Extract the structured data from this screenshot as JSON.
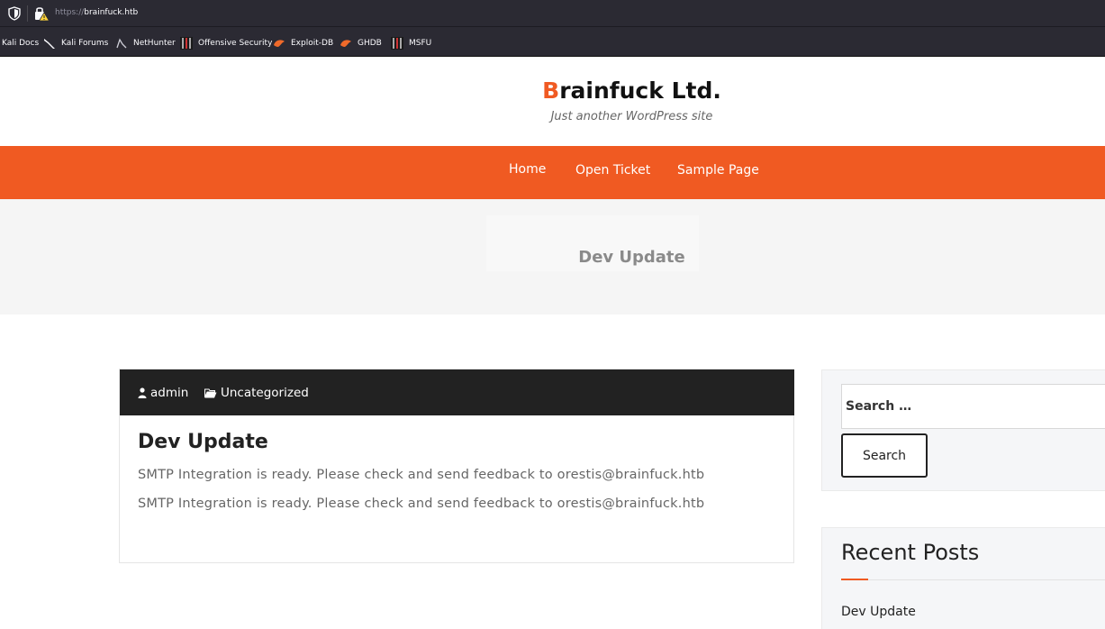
{
  "browser": {
    "url_protocol": "https://",
    "url_host": "brainfuck.htb",
    "bookmarks": [
      {
        "label": "Kali Docs",
        "icon": "kali-docs-icon"
      },
      {
        "label": "Kali Forums",
        "icon": "kali-dragon-icon"
      },
      {
        "label": "NetHunter",
        "icon": "nethunter-icon"
      },
      {
        "label": "Offensive Security",
        "icon": "offsec-icon"
      },
      {
        "label": "Exploit-DB",
        "icon": "exploitdb-icon"
      },
      {
        "label": "GHDB",
        "icon": "ghdb-icon"
      },
      {
        "label": "MSFU",
        "icon": "msfu-icon"
      }
    ]
  },
  "site": {
    "title_first": "B",
    "title_rest": "rainfuck Ltd.",
    "tagline": "Just another WordPress site",
    "accent_color": "#f05a22"
  },
  "nav": {
    "items": [
      {
        "label": "Home"
      },
      {
        "label": "Open Ticket"
      },
      {
        "label": "Sample Page"
      }
    ]
  },
  "banner": {
    "title": "Dev Update"
  },
  "post": {
    "author": "admin",
    "category": "Uncategorized",
    "title": "Dev Update",
    "lines": [
      "SMTP Integration is ready. Please check and send feedback to orestis@brainfuck.htb",
      "SMTP Integration is ready. Please check and send feedback to orestis@brainfuck.htb"
    ]
  },
  "sidebar": {
    "search_placeholder": "Search …",
    "search_button": "Search",
    "recent_heading": "Recent Posts",
    "recent_posts": [
      "Dev Update"
    ]
  }
}
